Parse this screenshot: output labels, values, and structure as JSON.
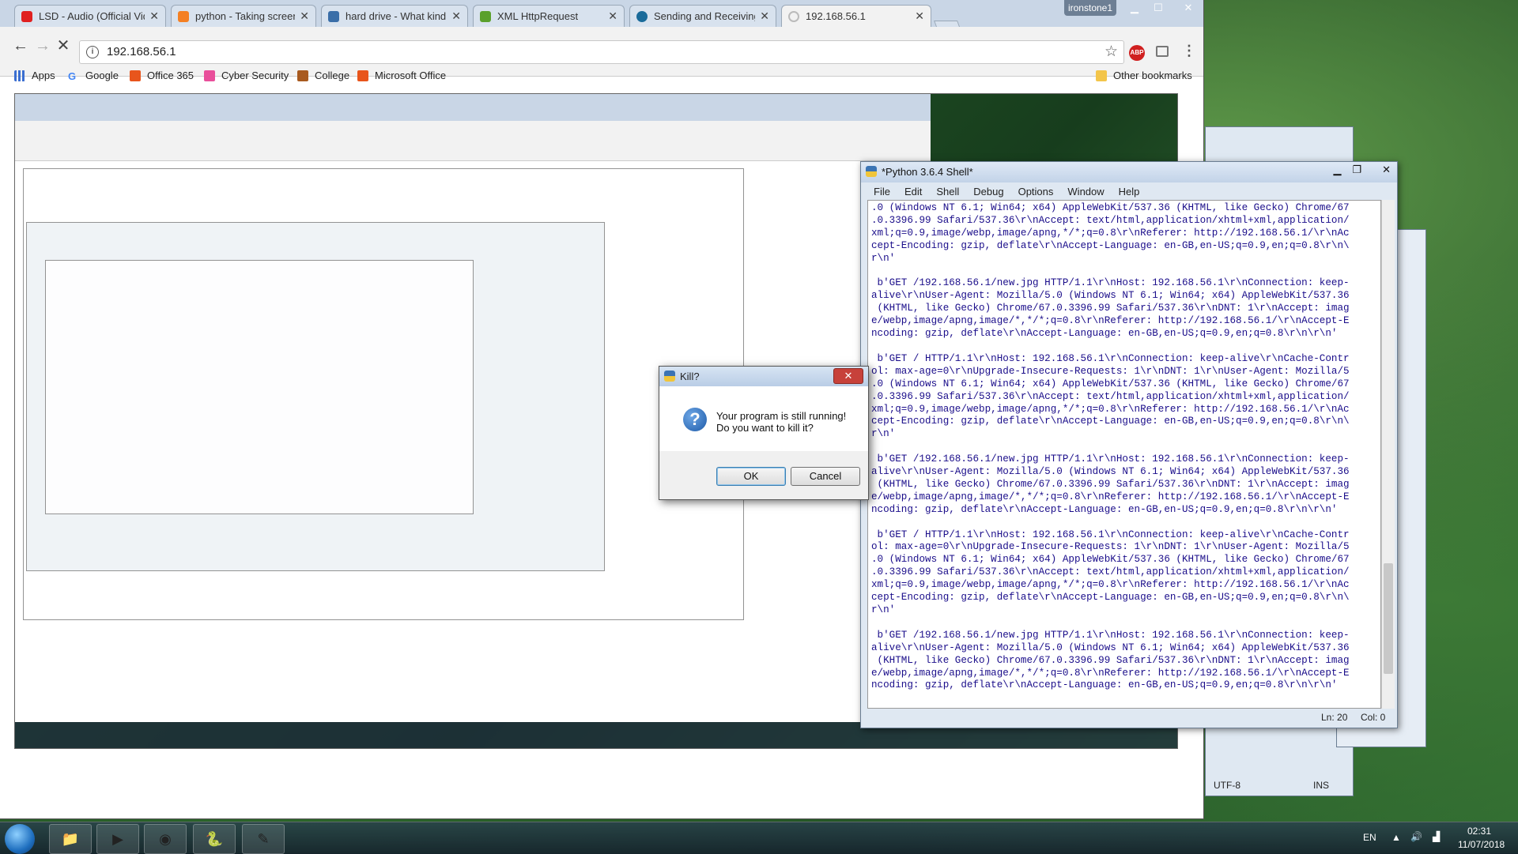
{
  "browser": {
    "user": "ironstone1",
    "tabs": [
      {
        "label": "LSD - Audio (Official Vide",
        "fav_color": "#e02020"
      },
      {
        "label": "python - Taking screensh",
        "fav_color": "#f48024"
      },
      {
        "label": "hard drive - What kind of",
        "fav_color": "#3a6ea8"
      },
      {
        "label": "XML HttpRequest",
        "fav_color": "#5aa02c"
      },
      {
        "label": "Sending and Receiving B",
        "fav_color": "#1a6b9a"
      },
      {
        "label": "192.168.56.1",
        "fav_color": "#dddddd"
      }
    ],
    "url": "192.168.56.1",
    "bookmarks": [
      "Apps",
      "Google",
      "Office 365",
      "Cyber Security",
      "College",
      "Microsoft Office"
    ],
    "other_bookmarks": "Other bookmarks"
  },
  "idle": {
    "title": "*Python 3.6.4 Shell*",
    "menu": [
      "File",
      "Edit",
      "Shell",
      "Debug",
      "Options",
      "Window",
      "Help"
    ],
    "lines": [
      ".0 (Windows NT 6.1; Win64; x64) AppleWebKit/537.36 (KHTML, like Gecko) Chrome/67",
      ".0.3396.99 Safari/537.36\\r\\nAccept: text/html,application/xhtml+xml,application/",
      "xml;q=0.9,image/webp,image/apng,*/*;q=0.8\\r\\nReferer: http://192.168.56.1/\\r\\nAc",
      "cept-Encoding: gzip, deflate\\r\\nAccept-Language: en-GB,en-US;q=0.9,en;q=0.8\\r\\n\\",
      "r\\n'",
      "",
      " b'GET /192.168.56.1/new.jpg HTTP/1.1\\r\\nHost: 192.168.56.1\\r\\nConnection: keep-",
      "alive\\r\\nUser-Agent: Mozilla/5.0 (Windows NT 6.1; Win64; x64) AppleWebKit/537.36",
      " (KHTML, like Gecko) Chrome/67.0.3396.99 Safari/537.36\\r\\nDNT: 1\\r\\nAccept: imag",
      "e/webp,image/apng,image/*,*/*;q=0.8\\r\\nReferer: http://192.168.56.1/\\r\\nAccept-E",
      "ncoding: gzip, deflate\\r\\nAccept-Language: en-GB,en-US;q=0.9,en;q=0.8\\r\\n\\r\\n'",
      "",
      " b'GET / HTTP/1.1\\r\\nHost: 192.168.56.1\\r\\nConnection: keep-alive\\r\\nCache-Contr",
      "ol: max-age=0\\r\\nUpgrade-Insecure-Requests: 1\\r\\nDNT: 1\\r\\nUser-Agent: Mozilla/5",
      ".0 (Windows NT 6.1; Win64; x64) AppleWebKit/537.36 (KHTML, like Gecko) Chrome/67",
      ".0.3396.99 Safari/537.36\\r\\nAccept: text/html,application/xhtml+xml,application/",
      "xml;q=0.9,image/webp,image/apng,*/*;q=0.8\\r\\nReferer: http://192.168.56.1/\\r\\nAc",
      "cept-Encoding: gzip, deflate\\r\\nAccept-Language: en-GB,en-US;q=0.9,en;q=0.8\\r\\n\\",
      "r\\n'",
      "",
      " b'GET /192.168.56.1/new.jpg HTTP/1.1\\r\\nHost: 192.168.56.1\\r\\nConnection: keep-",
      "alive\\r\\nUser-Agent: Mozilla/5.0 (Windows NT 6.1; Win64; x64) AppleWebKit/537.36",
      " (KHTML, like Gecko) Chrome/67.0.3396.99 Safari/537.36\\r\\nDNT: 1\\r\\nAccept: imag",
      "e/webp,image/apng,image/*,*/*;q=0.8\\r\\nReferer: http://192.168.56.1/\\r\\nAccept-E",
      "ncoding: gzip, deflate\\r\\nAccept-Language: en-GB,en-US;q=0.9,en;q=0.8\\r\\n\\r\\n'",
      "",
      " b'GET / HTTP/1.1\\r\\nHost: 192.168.56.1\\r\\nConnection: keep-alive\\r\\nCache-Contr",
      "ol: max-age=0\\r\\nUpgrade-Insecure-Requests: 1\\r\\nDNT: 1\\r\\nUser-Agent: Mozilla/5",
      ".0 (Windows NT 6.1; Win64; x64) AppleWebKit/537.36 (KHTML, like Gecko) Chrome/67",
      ".0.3396.99 Safari/537.36\\r\\nAccept: text/html,application/xhtml+xml,application/",
      "xml;q=0.9,image/webp,image/apng,*/*;q=0.8\\r\\nReferer: http://192.168.56.1/\\r\\nAc",
      "cept-Encoding: gzip, deflate\\r\\nAccept-Language: en-GB,en-US;q=0.9,en;q=0.8\\r\\n\\",
      "r\\n'",
      "",
      " b'GET /192.168.56.1/new.jpg HTTP/1.1\\r\\nHost: 192.168.56.1\\r\\nConnection: keep-",
      "alive\\r\\nUser-Agent: Mozilla/5.0 (Windows NT 6.1; Win64; x64) AppleWebKit/537.36",
      " (KHTML, like Gecko) Chrome/67.0.3396.99 Safari/537.36\\r\\nDNT: 1\\r\\nAccept: imag",
      "e/webp,image/apng,image/*,*/*;q=0.8\\r\\nReferer: http://192.168.56.1/\\r\\nAccept-E",
      "ncoding: gzip, deflate\\r\\nAccept-Language: en-GB,en-US;q=0.9,en;q=0.8\\r\\n\\r\\n'"
    ],
    "status_line": "Ln: 20",
    "status_col": "Col: 0"
  },
  "back_window": {
    "encoding": "UTF-8",
    "mode": "INS"
  },
  "dialog": {
    "title": "Kill?",
    "close": "✕",
    "message_line1": "Your program is still running!",
    "message_line2": "Do you want to kill it?",
    "ok": "OK",
    "cancel": "Cancel"
  },
  "taskbar": {
    "lang": "EN",
    "time": "02:31",
    "date": "11/07/2018"
  }
}
